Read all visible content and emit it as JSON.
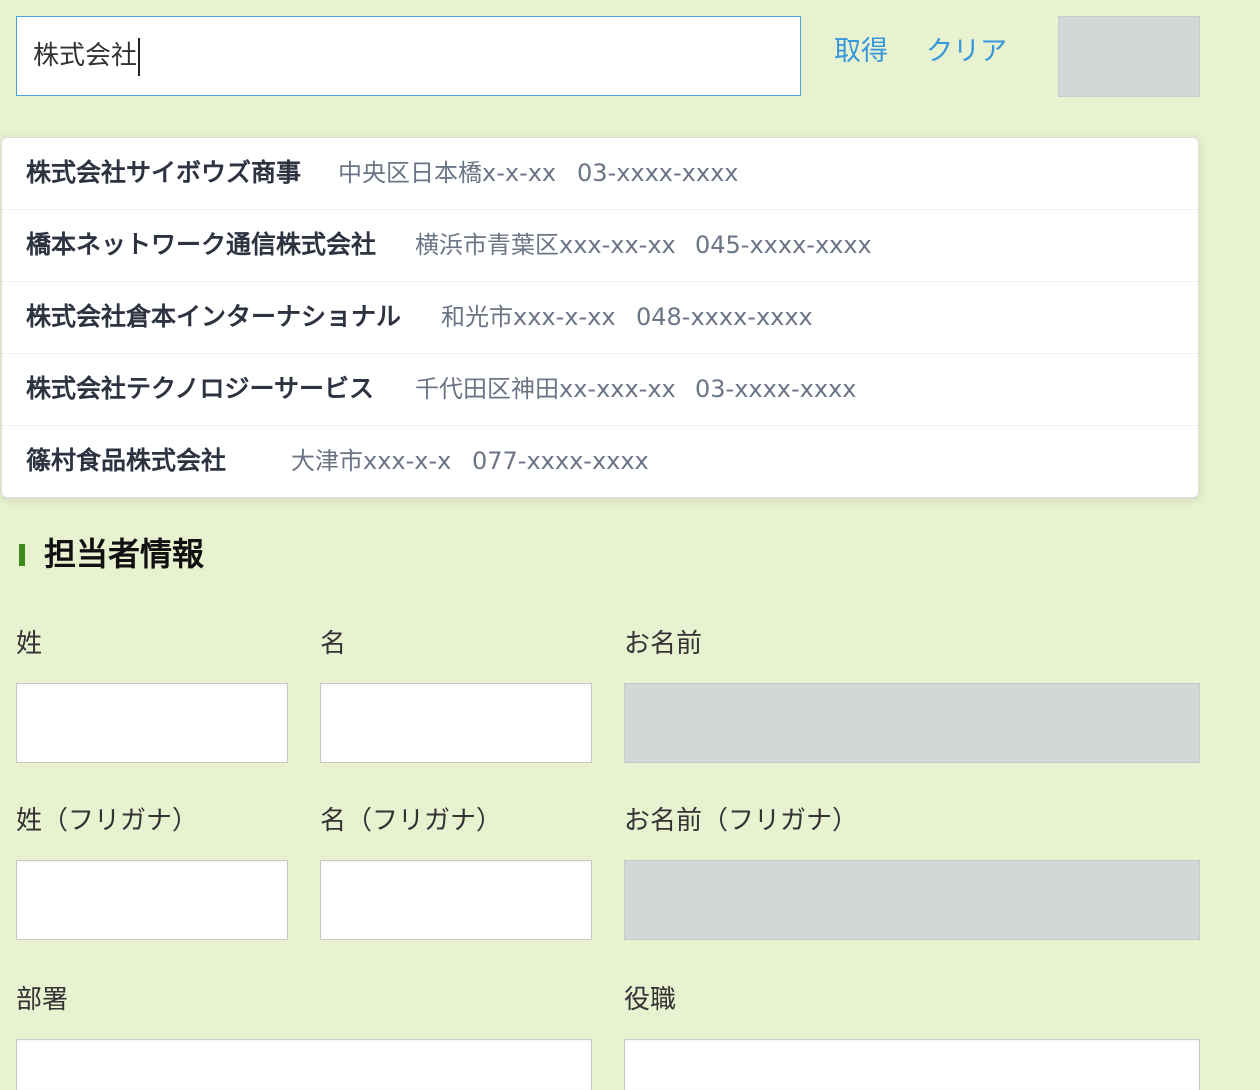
{
  "search": {
    "value": "株式会社",
    "get_label": "取得",
    "clear_label": "クリア"
  },
  "suggestions": [
    {
      "name": "株式会社サイボウズ商事",
      "address": "中央区日本橋x-x-xx",
      "tel": "03-xxxx-xxxx"
    },
    {
      "name": "橋本ネットワーク通信株式会社",
      "address": "横浜市青葉区xxx-xx-xx",
      "tel": "045-xxxx-xxxx"
    },
    {
      "name": "株式会社倉本インターナショナル",
      "address": "和光市xxx-x-xx",
      "tel": "048-xxxx-xxxx"
    },
    {
      "name": "株式会社テクノロジーサービス",
      "address": "千代田区神田xx-xxx-xx",
      "tel": "03-xxxx-xxxx"
    },
    {
      "name": "篠村食品株式会社",
      "address": "大津市xxx-x-x",
      "tel": "077-xxxx-xxxx"
    }
  ],
  "contact_section": {
    "title": "担当者情報",
    "labels": {
      "last_name": "姓",
      "first_name": "名",
      "full_name": "お名前",
      "last_name_kana": "姓（フリガナ）",
      "first_name_kana": "名（フリガナ）",
      "full_name_kana": "お名前（フリガナ）",
      "department": "部署",
      "position": "役職"
    }
  },
  "colors": {
    "background": "#e8f1d0",
    "link": "#3598db",
    "accent_bar": "#3d8a1c",
    "readonly": "#d4d7d7"
  }
}
